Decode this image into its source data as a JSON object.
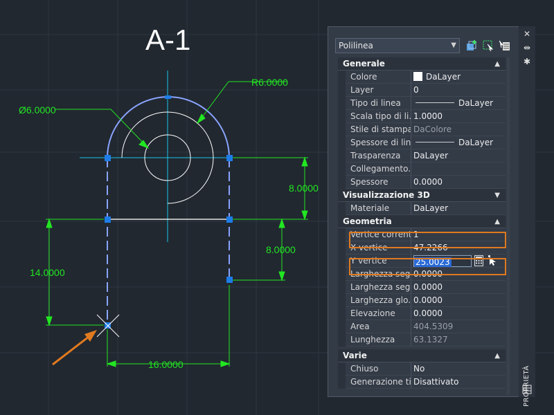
{
  "drawing": {
    "title": "A-1",
    "dimensions": {
      "radius": "R6.0000",
      "diameter": "Ø6.0000",
      "right_upper": "8.0000",
      "right_lower": "8.0000",
      "left_height": "14.0000",
      "bottom_width": "16.0000"
    },
    "colors": {
      "background": "#212830",
      "grid": "#2e3640",
      "polyline": "#8aa4ff",
      "grips": "#1e7ce6",
      "dimension": "#22e622",
      "centerline": "#19c6e6",
      "annotation_arrow": "#e07a20"
    }
  },
  "palette": {
    "object_type": "Polilinea",
    "side_title": "PROPRIETÀ",
    "sections": {
      "generale": {
        "title": "Generale",
        "rows": [
          {
            "label": "Colore",
            "value": "DaLayer"
          },
          {
            "label": "Layer",
            "value": "0"
          },
          {
            "label": "Tipo di linea",
            "value": "DaLayer"
          },
          {
            "label": "Scala tipo di li...",
            "value": "1.0000"
          },
          {
            "label": "Stile di stampa",
            "value": "DaColore"
          },
          {
            "label": "Spessore di lin...",
            "value": "DaLayer"
          },
          {
            "label": "Trasparenza",
            "value": "DaLayer"
          },
          {
            "label": "Collegamento...",
            "value": ""
          },
          {
            "label": "Spessore",
            "value": "0.0000"
          }
        ]
      },
      "visualizzazione": {
        "title": "Visualizzazione 3D",
        "rows": [
          {
            "label": "Materiale",
            "value": "DaLayer"
          }
        ]
      },
      "geometria": {
        "title": "Geometria",
        "rows": [
          {
            "label": "Vertice corrente",
            "value": "1"
          },
          {
            "label": "X vertice",
            "value": "47.2266"
          },
          {
            "label": "Y vertice",
            "value": "25.0023"
          },
          {
            "label": "Larghezza seg...",
            "value": "0.0000"
          },
          {
            "label": "Larghezza seg...",
            "value": "0.0000"
          },
          {
            "label": "Larghezza glo...",
            "value": "0.0000"
          },
          {
            "label": "Elevazione",
            "value": "0.0000"
          },
          {
            "label": "Area",
            "value": "404.5309"
          },
          {
            "label": "Lunghezza",
            "value": "63.1327"
          }
        ]
      },
      "varie": {
        "title": "Varie",
        "rows": [
          {
            "label": "Chiuso",
            "value": "No"
          },
          {
            "label": "Generazione ti...",
            "value": "Disattivato"
          }
        ]
      }
    },
    "highlight_color": "#e07a20",
    "selection_color": "#2a6ad6"
  }
}
